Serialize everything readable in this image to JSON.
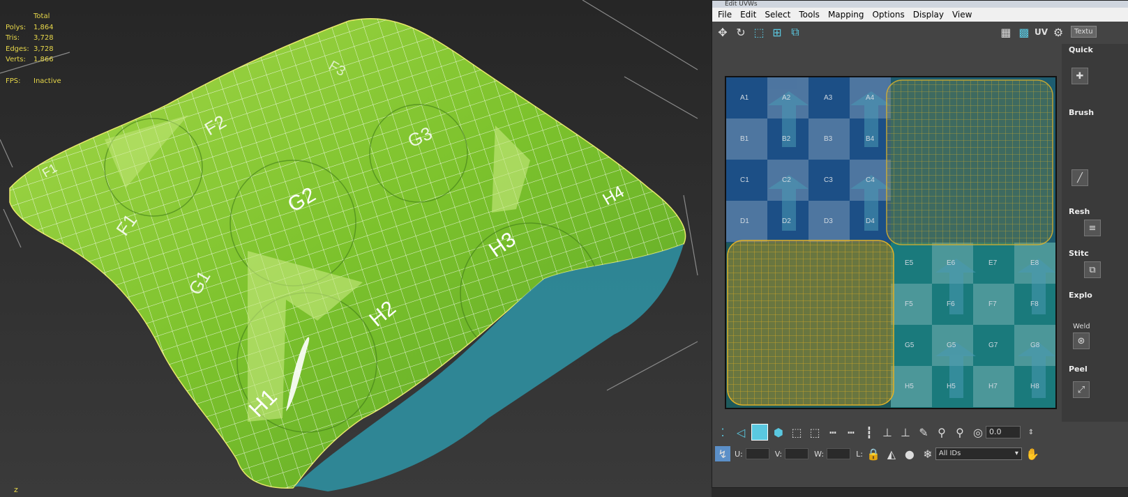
{
  "viewport": {
    "stats": {
      "header": "Total",
      "rows": [
        {
          "label": "Polys:",
          "value": "1,864"
        },
        {
          "label": "Tris:",
          "value": "3,728"
        },
        {
          "label": "Edges:",
          "value": "3,728"
        },
        {
          "label": "Verts:",
          "value": "1,866"
        }
      ],
      "fps_label": "FPS:",
      "fps_value": "Inactive"
    },
    "pillow_labels": [
      "F1",
      "F2",
      "F3",
      "G1",
      "G2",
      "G3",
      "H1",
      "H2",
      "H3",
      "H4",
      "F1"
    ],
    "axis_label": "z"
  },
  "uv_window": {
    "title": "Edit UVWs",
    "menu": [
      "File",
      "Edit",
      "Select",
      "Tools",
      "Mapping",
      "Options",
      "Display",
      "View"
    ],
    "toolbar": {
      "uv_label": "UV",
      "texture_dropdown": "Textu"
    },
    "side_panel": {
      "sections": [
        "Quick",
        "Brush",
        "Resh",
        "Stitc",
        "Explo",
        "Peel"
      ],
      "weld_label": "Weld"
    },
    "grid_labels": {
      "rows": [
        "A",
        "B",
        "C",
        "D",
        "E",
        "F",
        "G",
        "H"
      ],
      "top_left": [
        [
          "A1",
          "A2",
          "A3",
          "A4"
        ],
        [
          "B1",
          "B2",
          "B3",
          "B4"
        ],
        [
          "C1",
          "C2",
          "C3",
          "C4"
        ],
        [
          "D1",
          "D2",
          "D3",
          "D4"
        ]
      ],
      "bottom_right": [
        [
          "E5",
          "E6",
          "E7",
          "E8"
        ],
        [
          "F5",
          "F6",
          "F7",
          "F8"
        ],
        [
          "G5",
          "G5",
          "G7",
          "G8"
        ],
        [
          "H5",
          "H5",
          "H7",
          "H8"
        ]
      ]
    },
    "bottom_toolbar": {
      "value": "0.0"
    },
    "status_bar": {
      "u_label": "U:",
      "v_label": "V:",
      "w_label": "W:",
      "l_label": "L:",
      "id_filter": "All IDs"
    },
    "colors": {
      "uv_highlight": "#e8b82a",
      "checker_blue": "#1c4f86",
      "checker_teal": "#1a7a7c"
    }
  }
}
